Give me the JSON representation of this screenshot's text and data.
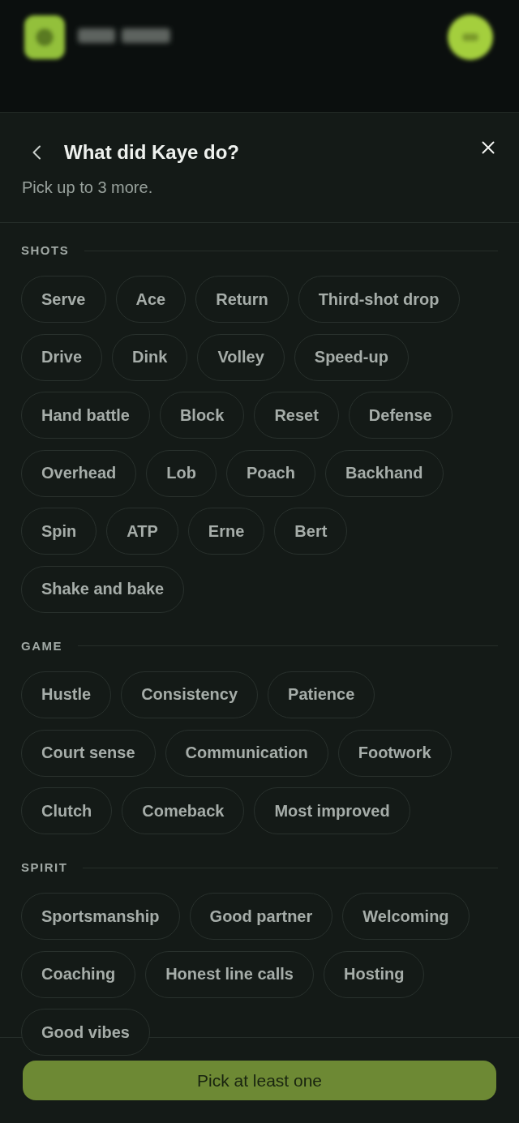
{
  "dialog": {
    "title": "What did Kaye do?",
    "subtitle": "Pick up to 3 more."
  },
  "sections": [
    {
      "title": "SHOTS",
      "chips": [
        {
          "label": "Serve",
          "selected": false
        },
        {
          "label": "Ace",
          "selected": false
        },
        {
          "label": "Return",
          "selected": false
        },
        {
          "label": "Third-shot drop",
          "selected": false
        },
        {
          "label": "Drive",
          "selected": false
        },
        {
          "label": "Dink",
          "selected": false
        },
        {
          "label": "Volley",
          "selected": false
        },
        {
          "label": "Speed-up",
          "selected": false
        },
        {
          "label": "Hand battle",
          "selected": false
        },
        {
          "label": "Block",
          "selected": false
        },
        {
          "label": "Reset",
          "selected": false
        },
        {
          "label": "Defense",
          "selected": false
        },
        {
          "label": "Overhead",
          "selected": false
        },
        {
          "label": "Lob",
          "selected": false
        },
        {
          "label": "Poach",
          "selected": false
        },
        {
          "label": "Backhand",
          "selected": false
        },
        {
          "label": "Spin",
          "selected": false
        },
        {
          "label": "ATP",
          "selected": false
        },
        {
          "label": "Erne",
          "selected": false
        },
        {
          "label": "Bert",
          "selected": false
        },
        {
          "label": "Shake and bake",
          "selected": false
        }
      ]
    },
    {
      "title": "GAME",
      "chips": [
        {
          "label": "Hustle",
          "selected": false
        },
        {
          "label": "Consistency",
          "selected": false
        },
        {
          "label": "Patience",
          "selected": false
        },
        {
          "label": "Court sense",
          "selected": false
        },
        {
          "label": "Communication",
          "selected": false
        },
        {
          "label": "Footwork",
          "selected": false
        },
        {
          "label": "Clutch",
          "selected": false
        },
        {
          "label": "Comeback",
          "selected": false
        },
        {
          "label": "Most improved",
          "selected": false
        }
      ]
    },
    {
      "title": "SPIRIT",
      "chips": [
        {
          "label": "Sportsmanship",
          "selected": false
        },
        {
          "label": "Good partner",
          "selected": false
        },
        {
          "label": "Welcoming",
          "selected": false
        },
        {
          "label": "Coaching",
          "selected": false
        },
        {
          "label": "Honest line calls",
          "selected": false
        },
        {
          "label": "Hosting",
          "selected": false
        },
        {
          "label": "Good vibes",
          "selected": false
        }
      ]
    }
  ],
  "submit_button": {
    "label": "Pick at least one",
    "disabled": true
  }
}
